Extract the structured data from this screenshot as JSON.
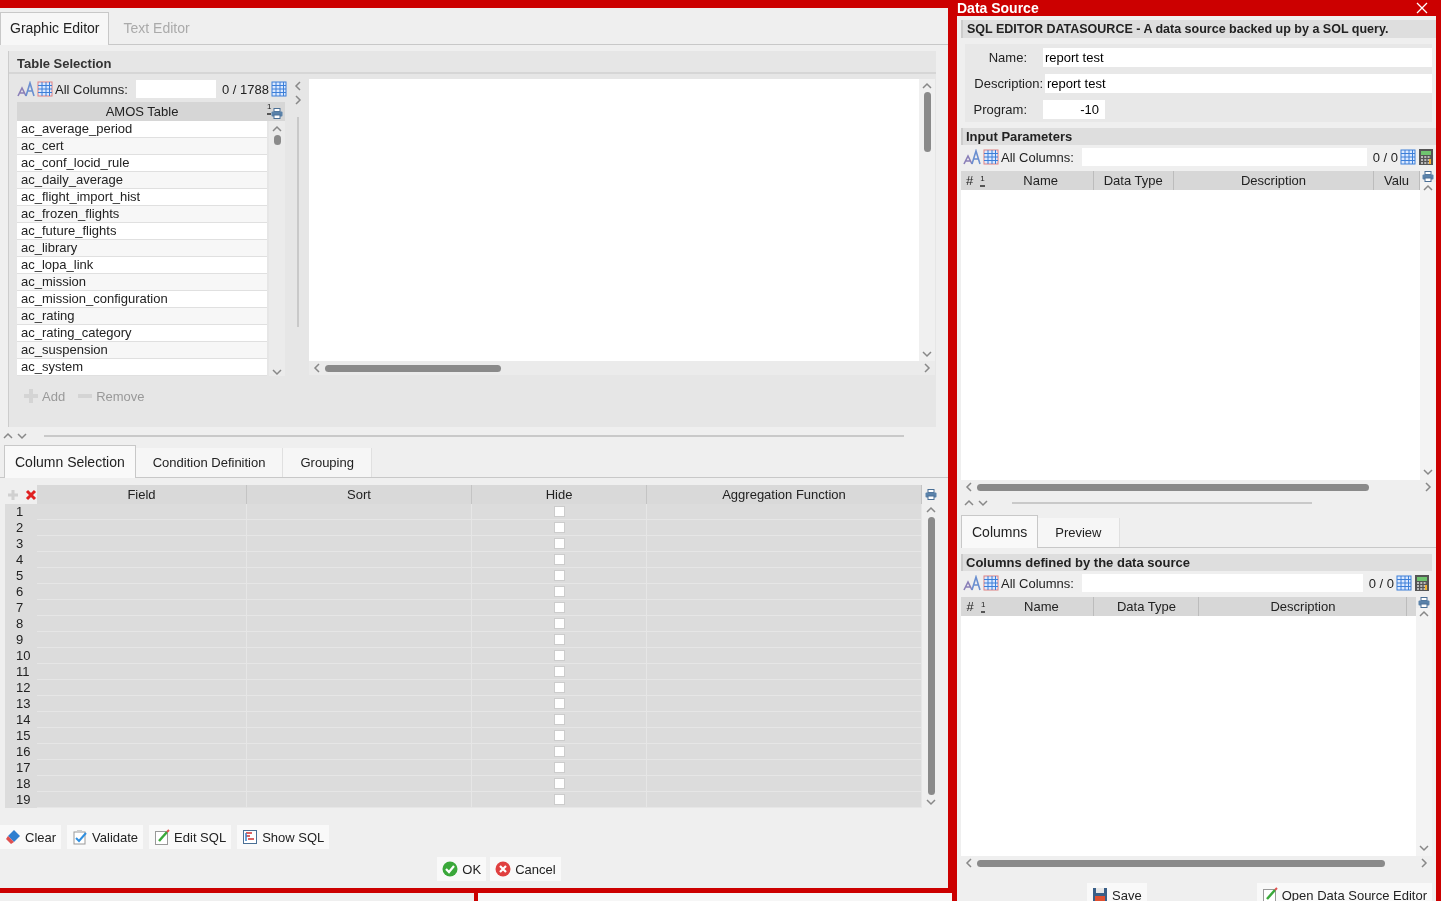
{
  "editor_tabs": [
    {
      "label": "Graphic Editor",
      "selected": true,
      "disabled": false
    },
    {
      "label": "Text Editor",
      "selected": false,
      "disabled": true
    }
  ],
  "table_selection": {
    "title": "Table Selection",
    "filter_label": "All Columns:",
    "count": "0 / 1788",
    "column": "AMOS Table",
    "sort_mark": "1",
    "tables": [
      "ac_average_period",
      "ac_cert",
      "ac_conf_locid_rule",
      "ac_daily_average",
      "ac_flight_import_hist",
      "ac_frozen_flights",
      "ac_future_flights",
      "ac_library",
      "ac_lopa_link",
      "ac_mission",
      "ac_mission_configuration",
      "ac_rating",
      "ac_rating_category",
      "ac_suspension",
      "ac_system"
    ]
  },
  "table_actions": [
    {
      "label": "Add",
      "kind": "add",
      "disabled": true
    },
    {
      "label": "Remove",
      "kind": "remove",
      "disabled": true
    }
  ],
  "query_tabs": [
    {
      "label": "Column Selection",
      "selected": true
    },
    {
      "label": "Condition Definition",
      "selected": false
    },
    {
      "label": "Grouping",
      "selected": false
    }
  ],
  "column_grid": {
    "columns": [
      "Field",
      "Sort",
      "Hide",
      "Aggregation Function"
    ],
    "rows": [
      {
        "number": "1",
        "hide": false
      },
      {
        "number": "2",
        "hide": false
      },
      {
        "number": "3",
        "hide": false
      },
      {
        "number": "4",
        "hide": false
      },
      {
        "number": "5",
        "hide": false
      },
      {
        "number": "6",
        "hide": false
      },
      {
        "number": "7",
        "hide": false
      },
      {
        "number": "8",
        "hide": false
      },
      {
        "number": "9",
        "hide": false
      },
      {
        "number": "10",
        "hide": false
      },
      {
        "number": "11",
        "hide": false
      },
      {
        "number": "12",
        "hide": false
      },
      {
        "number": "13",
        "hide": false
      },
      {
        "number": "14",
        "hide": false
      },
      {
        "number": "15",
        "hide": false
      },
      {
        "number": "16",
        "hide": false
      },
      {
        "number": "17",
        "hide": false
      },
      {
        "number": "18",
        "hide": false
      },
      {
        "number": "19",
        "hide": false
      }
    ]
  },
  "tool_buttons": [
    {
      "label": "Clear",
      "kind": "eraser"
    },
    {
      "label": "Validate",
      "kind": "validate"
    },
    {
      "label": "Edit SQL",
      "kind": "edit"
    },
    {
      "label": "Show SQL",
      "kind": "show"
    }
  ],
  "dialog_buttons": [
    {
      "label": "OK",
      "kind": "ok"
    },
    {
      "label": "Cancel",
      "kind": "cancel"
    }
  ],
  "data_source": {
    "title": "Data Source",
    "heading": "SQL EDITOR DATASOURCE - A data source backed up by a SOL query.",
    "fields": [
      {
        "label": "Name:",
        "value": "report test",
        "kind": "wide"
      },
      {
        "label": "Description:",
        "value": "report test",
        "kind": "wide"
      },
      {
        "label": "Program:",
        "value": "-10",
        "kind": "number"
      }
    ],
    "input_parameters": {
      "title": "Input Parameters",
      "filter_label": "All Columns:",
      "count": "0 / 0",
      "number_column": "#",
      "sort_mark": "1",
      "columns": [
        "Name",
        "Data Type",
        "Description",
        "Valu"
      ]
    },
    "tabs": [
      {
        "label": "Columns",
        "selected": true
      },
      {
        "label": "Preview",
        "selected": false
      }
    ],
    "columns_panel": {
      "title": "Columns defined by the data source",
      "filter_label": "All Columns:",
      "count": "0 / 0",
      "number_column": "#",
      "sort_mark": "1",
      "columns": [
        "Name",
        "Data Type",
        "Description"
      ]
    },
    "buttons": [
      {
        "label": "Save",
        "kind": "save"
      },
      {
        "label": "Open Data Source Editor",
        "kind": "edit"
      }
    ]
  }
}
